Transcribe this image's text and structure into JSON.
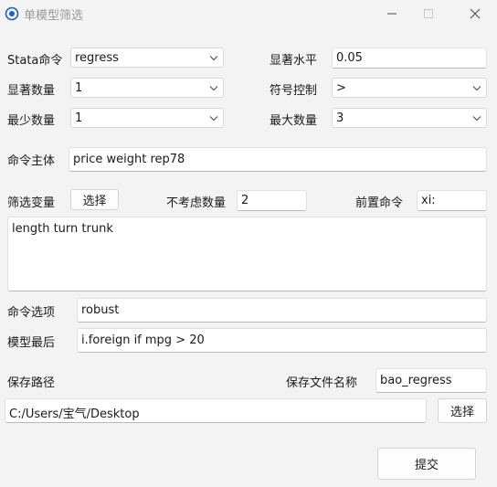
{
  "window": {
    "title": "单模型筛选"
  },
  "form": {
    "stata_command": {
      "label": "Stata命令",
      "value": "regress"
    },
    "significance_level": {
      "label": "显著水平",
      "value": "0.05"
    },
    "significant_count": {
      "label": "显著数量",
      "value": "1"
    },
    "sign_control": {
      "label": "符号控制",
      "value": ">"
    },
    "min_count": {
      "label": "最少数量",
      "value": "1"
    },
    "max_count": {
      "label": "最大数量",
      "value": "3"
    },
    "command_body": {
      "label": "命令主体",
      "value": "price weight rep78"
    },
    "filter_vars": {
      "label": "筛选变量",
      "button": "选择",
      "text": "length turn trunk"
    },
    "ignore_count": {
      "label": "不考虑数量",
      "value": "2"
    },
    "prefix_command": {
      "label": "前置命令",
      "value": "xi:"
    },
    "command_options": {
      "label": "命令选项",
      "value": "robust"
    },
    "model_last": {
      "label": "模型最后",
      "value": "i.foreign if mpg > 20"
    },
    "save_path": {
      "label": "保存路径",
      "value": "C:/Users/宝气/Desktop",
      "button": "选择"
    },
    "save_filename": {
      "label": "保存文件名称",
      "value": "bao_regress"
    },
    "submit": "提交"
  },
  "colors": {
    "background": "#f3f3f3",
    "input_background": "#ffffff",
    "title_text": "#9a9a9a",
    "accent": "#1f5fbf"
  }
}
